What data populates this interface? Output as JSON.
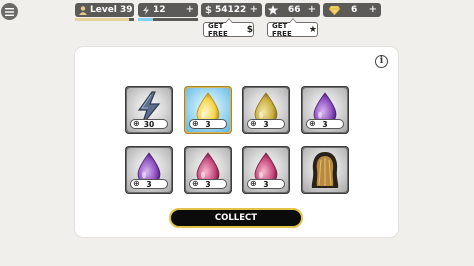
{
  "hud": {
    "level_label": "Level 39",
    "level_progress": 0.92,
    "energy_value": "12",
    "energy_progress": 0.25,
    "money_value": "54122",
    "stars_value": "66",
    "diamonds_value": "6",
    "plus_glyph": "+"
  },
  "get_free": [
    {
      "label": "GET FREE",
      "icon": "dollar-icon",
      "glyph": "$"
    },
    {
      "label": "GET FREE",
      "icon": "star-icon",
      "glyph": "★"
    }
  ],
  "info_glyph": "i",
  "rewards": [
    {
      "icon": "energy-bolt-icon",
      "quantity": "30",
      "selected": false
    },
    {
      "icon": "yellow-drop-icon",
      "quantity": "3",
      "selected": true
    },
    {
      "icon": "gold-drop-icon",
      "quantity": "3",
      "selected": false
    },
    {
      "icon": "purple-drop-icon",
      "quantity": "3",
      "selected": false
    },
    {
      "icon": "purple-drop-icon",
      "quantity": "3",
      "selected": false
    },
    {
      "icon": "pink-drop-icon",
      "quantity": "3",
      "selected": false
    },
    {
      "icon": "pink-drop-icon",
      "quantity": "3",
      "selected": false
    },
    {
      "icon": "hairstyle-icon",
      "quantity": "",
      "selected": false
    }
  ],
  "collect_label": "COLLECT",
  "colors": {
    "hud_bg": "#5b5a57",
    "level_bar": "#e7d29a",
    "energy_bar": "#7fd3ee",
    "button_border": "#e2c248",
    "selected_tile": "#d6b354"
  }
}
